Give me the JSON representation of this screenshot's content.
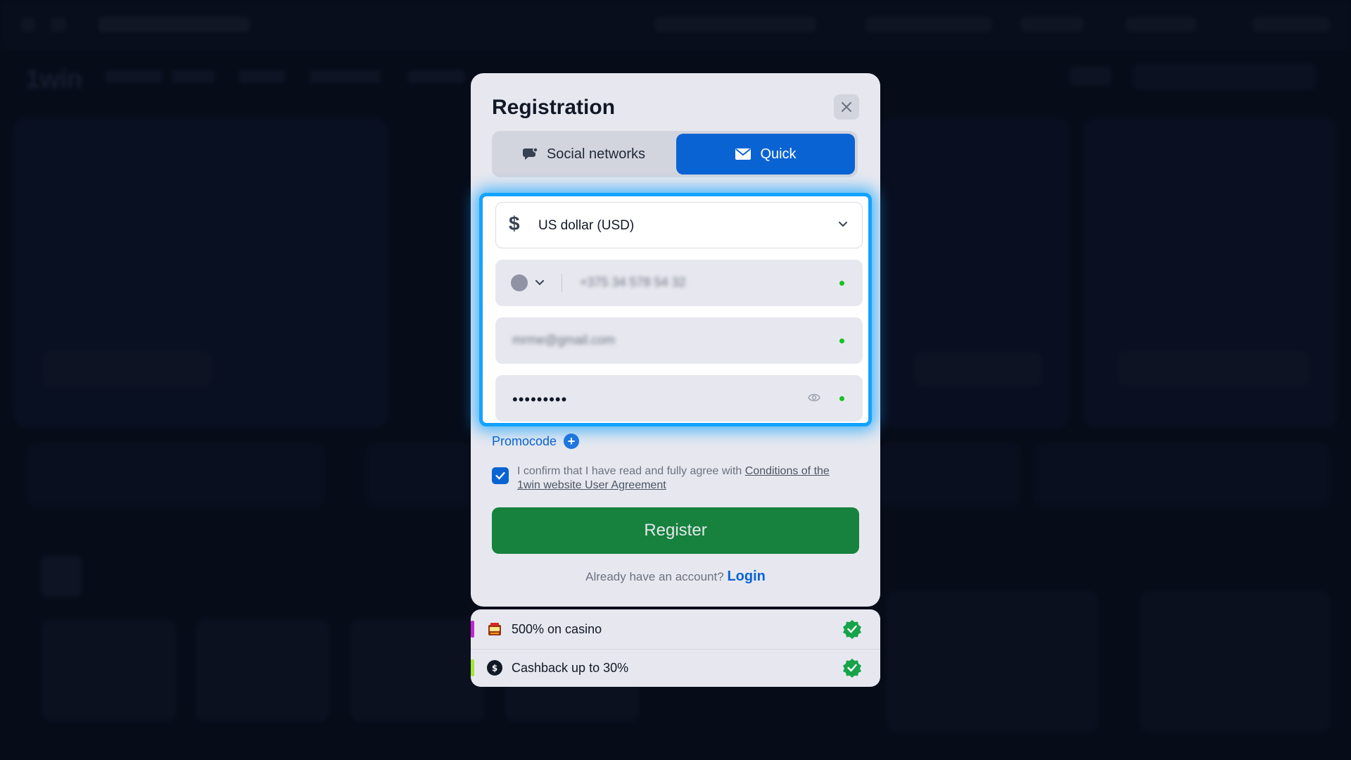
{
  "modal": {
    "title": "Registration",
    "tabs": [
      {
        "label": "Social networks",
        "icon": "chat-bubble-icon",
        "active": false
      },
      {
        "label": "Quick",
        "icon": "envelope-icon",
        "active": true
      }
    ],
    "currency": {
      "symbol": "$",
      "label": "US dollar (USD)"
    },
    "phone": {
      "value": "+375 34 578 54 32"
    },
    "email": {
      "value": "mrme@gmail.com"
    },
    "password": {
      "value": "•••••••••"
    },
    "promocode_label": "Promocode",
    "agreement": {
      "text": "I confirm that I have read and fully agree with ",
      "link": "Conditions of the 1win website User Agreement",
      "checked": true
    },
    "register_label": "Register",
    "login_prompt": "Already have an account?",
    "login_link": "Login"
  },
  "bonuses": [
    {
      "label": "500% on casino",
      "icon": "slot-machine-icon",
      "accent": "#c026d3"
    },
    {
      "label": "Cashback up to 30%",
      "icon": "dollar-cycle-icon",
      "accent": "#a3e635"
    }
  ],
  "colors": {
    "accent_blue": "#0a63d3",
    "highlight_blue": "#12a3ff",
    "register_green": "#16823e",
    "valid_green": "#16c321"
  }
}
